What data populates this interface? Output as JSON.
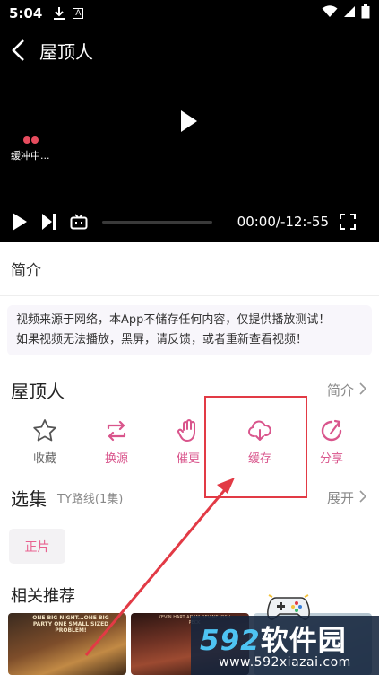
{
  "status_bar": {
    "time": "5:04",
    "icons": [
      "download-icon",
      "a-badge-icon",
      "wifi-icon",
      "signal-icon",
      "battery-icon"
    ],
    "a_badge": "A"
  },
  "player": {
    "title": "屋顶人",
    "loading_text": "缓冲中...",
    "timecode": "00:00/-12:-55",
    "progress": 0
  },
  "intro_tab": {
    "label": "简介"
  },
  "notice": {
    "line1": "视频来源于网络，本App不储存任何内容，仅提供播放测试！",
    "line2": "如果视频无法播放，黑屏，请反馈，或者重新查看视频！"
  },
  "show": {
    "title": "屋顶人",
    "intro_link": "简介"
  },
  "actions": [
    {
      "label": "收藏",
      "icon": "star-icon",
      "color": "#666666"
    },
    {
      "label": "换源",
      "icon": "switch-source-icon",
      "color": "#d9558c"
    },
    {
      "label": "催更",
      "icon": "hand-icon",
      "color": "#d9558c"
    },
    {
      "label": "缓存",
      "icon": "cloud-download-icon",
      "color": "#d9558c"
    },
    {
      "label": "分享",
      "icon": "share-icon",
      "color": "#d9558c"
    }
  ],
  "episodes": {
    "title": "选集",
    "route": "TY路线(1集)",
    "expand": "展开",
    "items": [
      "正片"
    ]
  },
  "recommend": {
    "title": "相关推荐",
    "poster1_text": "ONE BIG NIGHT...ONE BIG PARTY ONE SMALL SIZED PROBLEM!",
    "poster2_text": "KEVIN HART ADAM DEVINE JOSH PECK"
  },
  "watermark": {
    "logo_num": "592",
    "logo_cn": "软件园",
    "url": "www.592xiazai.com"
  },
  "colors": {
    "accent_pink": "#d9558c",
    "highlight_red": "#e23a45",
    "player_bg": "#000000"
  }
}
